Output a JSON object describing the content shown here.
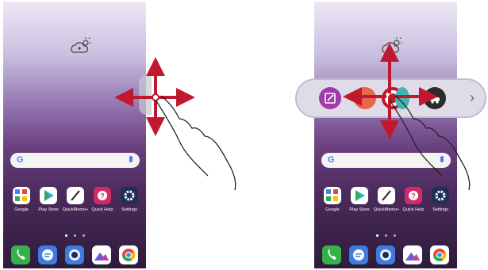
{
  "colors": {
    "arrow": "#c0182e",
    "hand_stroke": "#222222",
    "qbar_bg": "#e0dbe8",
    "qbar_border": "#c0bcc9"
  },
  "search": {
    "logo": "G"
  },
  "apps": [
    {
      "label": "Google",
      "icon": "google-folder-icon",
      "color": "#ffffff"
    },
    {
      "label": "Play Store",
      "icon": "play-store-icon",
      "color": "#ffffff"
    },
    {
      "label": "QuickMemo+",
      "icon": "quickmemo-icon",
      "color": "#ffffff"
    },
    {
      "label": "Quick Help",
      "icon": "quick-help-icon",
      "color": "#d12a6b"
    },
    {
      "label": "Settings",
      "icon": "settings-icon",
      "color": "#1f2f5a"
    }
  ],
  "dock": [
    {
      "icon": "phone-icon",
      "color": "#36b14a"
    },
    {
      "icon": "messages-icon",
      "color": "#3f7be0"
    },
    {
      "icon": "camera-icon",
      "color": "#3f7be0"
    },
    {
      "icon": "gallery-icon",
      "color": "#ffffff"
    },
    {
      "icon": "chrome-icon",
      "color": "#ffffff"
    }
  ],
  "quick_bar": {
    "chevron": "›",
    "buttons": [
      {
        "icon": "edit-icon",
        "color": "#a23aa8"
      },
      {
        "icon": "screen-capture-icon",
        "color": "#e8664b"
      },
      {
        "icon": "record-icon",
        "color": "#c0182e"
      },
      {
        "icon": "app-icon",
        "color": "#3fb6b0"
      },
      {
        "icon": "car-icon",
        "color": "#2b2b2b"
      }
    ]
  }
}
